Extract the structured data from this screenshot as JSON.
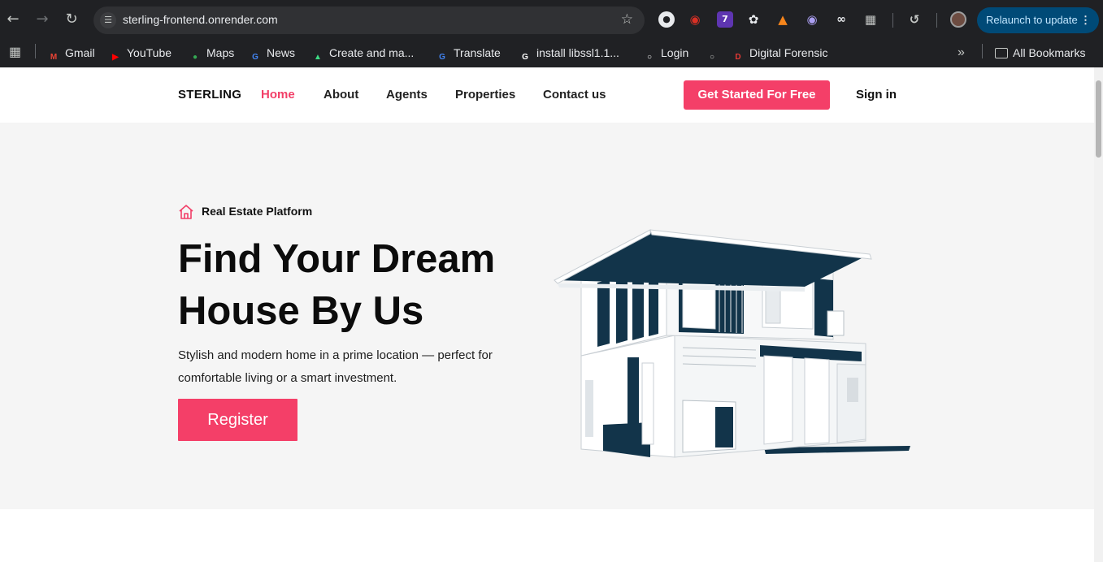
{
  "browser": {
    "url": "sterling-frontend.onrender.com",
    "relaunch_label": "Relaunch to update",
    "extension_badge": "7",
    "bookmarks": [
      {
        "label": "Gmail",
        "icon": "gmail-icon",
        "color": "#ea4335"
      },
      {
        "label": "YouTube",
        "icon": "youtube-icon",
        "color": "#ff0000"
      },
      {
        "label": "Maps",
        "icon": "maps-icon",
        "color": "#34a853"
      },
      {
        "label": "News",
        "icon": "news-icon",
        "color": "#4285f4"
      },
      {
        "label": "Create and ma...",
        "icon": "android-icon",
        "color": "#3ddc84"
      },
      {
        "label": "Translate",
        "icon": "translate-icon",
        "color": "#4285f4"
      },
      {
        "label": "install libssl1.1...",
        "icon": "google-icon",
        "color": "#ffffff"
      },
      {
        "label": "Login",
        "icon": "login-icon",
        "color": "#ffffff"
      },
      {
        "label": "",
        "icon": "globe-icon",
        "color": "#c4c7c5"
      },
      {
        "label": "Digital Forensic",
        "icon": "forensic-icon",
        "color": "#e53935"
      }
    ],
    "all_bookmarks_label": "All Bookmarks"
  },
  "site": {
    "logo": "STERLING",
    "nav": [
      {
        "label": "Home",
        "active": true
      },
      {
        "label": "About",
        "active": false
      },
      {
        "label": "Agents",
        "active": false
      },
      {
        "label": "Properties",
        "active": false
      },
      {
        "label": "Contact us",
        "active": false
      }
    ],
    "cta_label": "Get Started For Free",
    "signin_label": "Sign in",
    "accent_color": "#f43f68"
  },
  "hero": {
    "tag": "Real Estate Platform",
    "headline_line1": "Find Your Dream",
    "headline_line2": "House By Us",
    "subtext": "Stylish and modern home in a prime location — perfect for comfortable living or a smart investment.",
    "register_label": "Register"
  }
}
